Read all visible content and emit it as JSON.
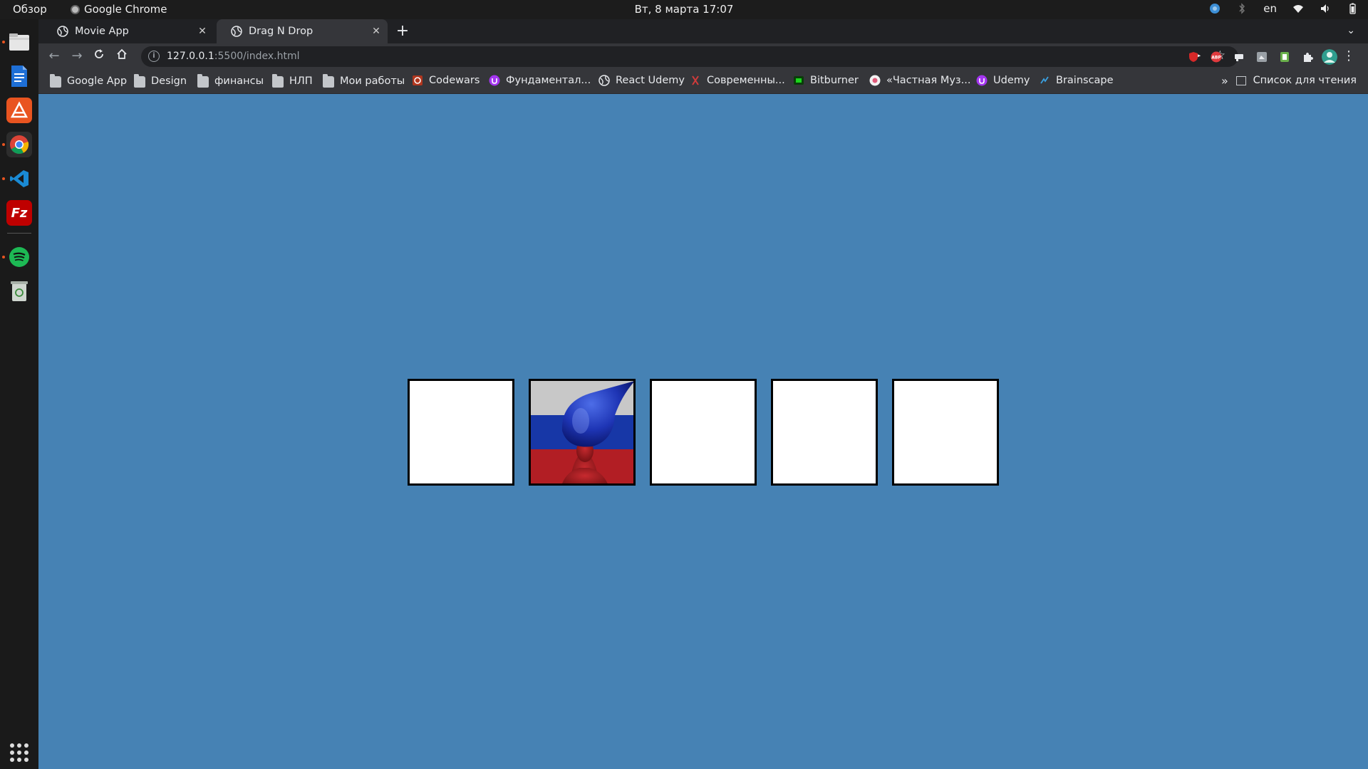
{
  "system": {
    "overview_label": "Обзор",
    "app_name": "Google Chrome",
    "clock": "Вт, 8 марта  17:07",
    "keyboard_layout": "en"
  },
  "dock": {
    "apps": [
      {
        "name": "files",
        "color": "#e8e8e8",
        "running": true
      },
      {
        "name": "writer",
        "color": "#1e6fd6",
        "running": false
      },
      {
        "name": "software",
        "color": "#e95420",
        "running": false
      },
      {
        "name": "chrome",
        "color": "#ffffff",
        "running": true
      },
      {
        "name": "vscode",
        "color": "#1a8ad4",
        "running": true
      },
      {
        "name": "filezilla",
        "color": "#bf0000",
        "running": false
      },
      {
        "name": "spotify",
        "color": "#1db954",
        "running": true
      },
      {
        "name": "trash",
        "color": "#cfd6cf",
        "running": false
      }
    ]
  },
  "browser": {
    "tabs": [
      {
        "title": "Movie App",
        "active": false
      },
      {
        "title": "Drag N Drop",
        "active": true
      }
    ],
    "url": {
      "host": "127.0.0.1",
      "rest": ":5500/index.html"
    },
    "bookmarks": [
      {
        "label": "Google App",
        "icon": "folder"
      },
      {
        "label": "Design",
        "icon": "folder"
      },
      {
        "label": "финансы",
        "icon": "folder"
      },
      {
        "label": "НЛП",
        "icon": "folder"
      },
      {
        "label": "Мои работы",
        "icon": "folder"
      },
      {
        "label": "Codewars",
        "icon": "codewars"
      },
      {
        "label": "Фундаментал...",
        "icon": "udemy"
      },
      {
        "label": "React Udemy",
        "icon": "globe"
      },
      {
        "label": "Современны...",
        "icon": "js"
      },
      {
        "label": "Bitburner",
        "icon": "bitburner"
      },
      {
        "label": "«Частная Муз...",
        "icon": "music"
      },
      {
        "label": "Udemy",
        "icon": "udemy"
      },
      {
        "label": "Brainscape",
        "icon": "brainscape"
      }
    ],
    "more_label": "»",
    "reading_list": "Список для чтения"
  },
  "page": {
    "background": "#4682b4",
    "empties": [
      {
        "has_fill": false
      },
      {
        "has_fill": true
      },
      {
        "has_fill": false
      },
      {
        "has_fill": false
      },
      {
        "has_fill": false
      }
    ]
  }
}
